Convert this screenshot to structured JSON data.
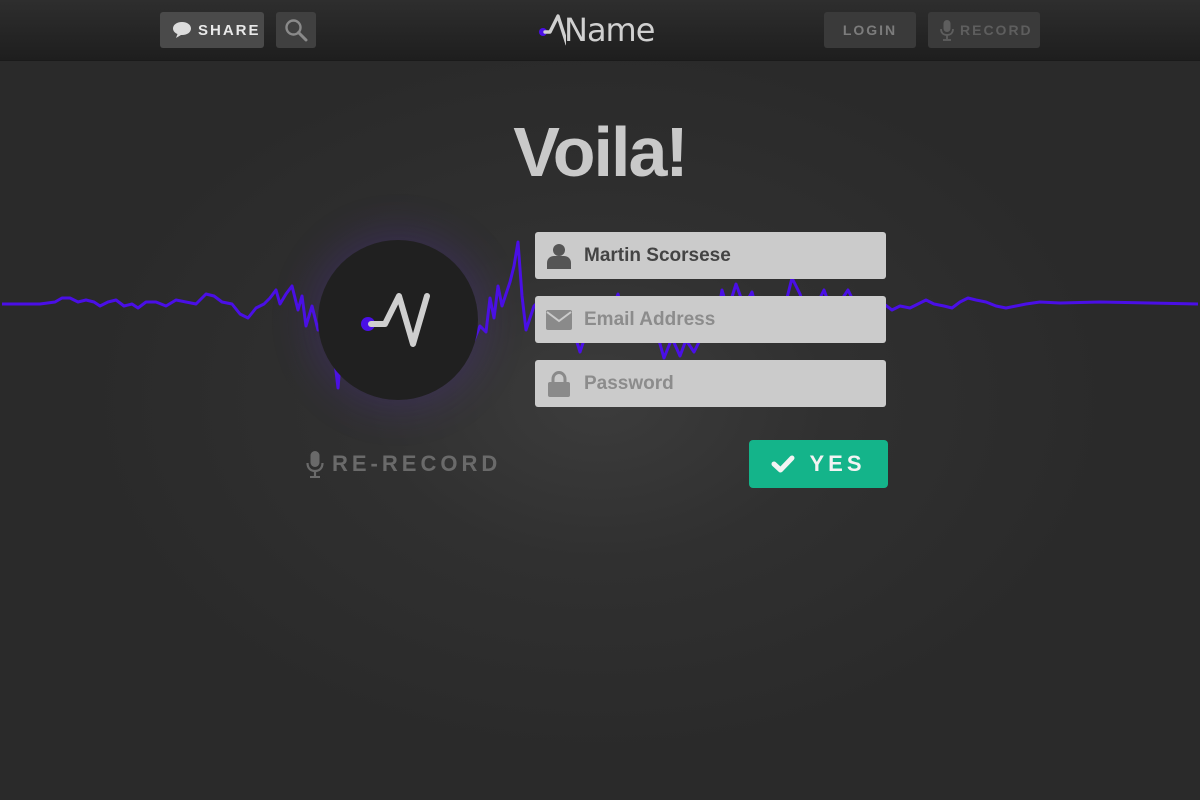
{
  "header": {
    "share_label": "SHARE",
    "logo_text": "Name",
    "login_label": "LOGIN",
    "record_label": "RECORD"
  },
  "main": {
    "title": "Voila!",
    "form": {
      "name_value": "Martin Scorsese",
      "email_placeholder": "Email Address",
      "password_placeholder": "Password"
    },
    "rerecord_label": "RE-RECORD",
    "yes_label": "YES"
  },
  "icons": {
    "share": "speech-bubble-icon",
    "search": "search-icon",
    "record": "microphone-icon",
    "name": "user-icon",
    "email": "envelope-icon",
    "password": "lock-icon",
    "yes": "checkmark-icon"
  },
  "colors": {
    "accent": "#4a0fe6",
    "confirm": "#14b48a",
    "background": "#2f2f2f"
  }
}
